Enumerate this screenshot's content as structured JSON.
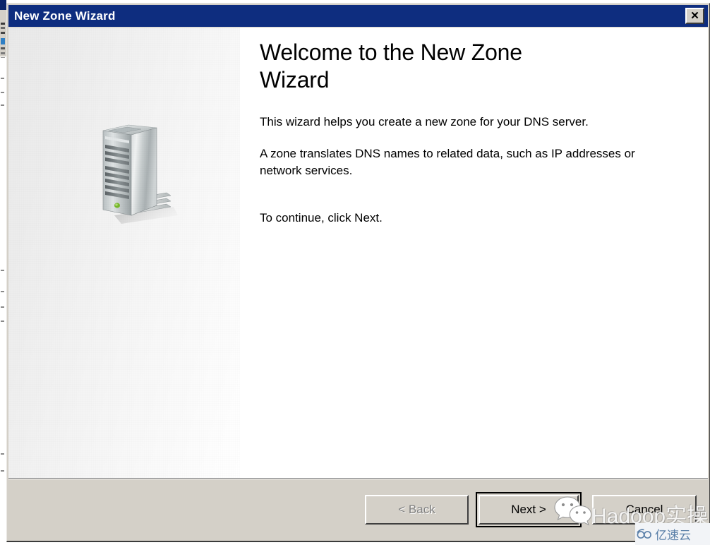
{
  "window": {
    "title": "New Zone Wizard",
    "close_label": "✕",
    "titlebar_color": "#0e2d7f",
    "face_color": "#d4d0c8"
  },
  "content": {
    "heading": "Welcome to the New Zone Wizard",
    "paragraph_1": "This wizard helps you create a new zone for your DNS server.",
    "paragraph_2": "A zone translates DNS names to related data, such as IP addresses or network services.",
    "paragraph_3": "To continue, click Next.",
    "illustration_name": "server-tower-illustration"
  },
  "buttons": {
    "back": "< Back",
    "next": "Next >",
    "cancel": "Cancel",
    "back_enabled": false,
    "next_is_default": true
  },
  "watermarks": {
    "wechat_text": "Hadoop实操",
    "wechat_icon": "wechat-logo-icon",
    "cloud_text": "亿速云",
    "cloud_icon": "cloud-logo-icon"
  }
}
